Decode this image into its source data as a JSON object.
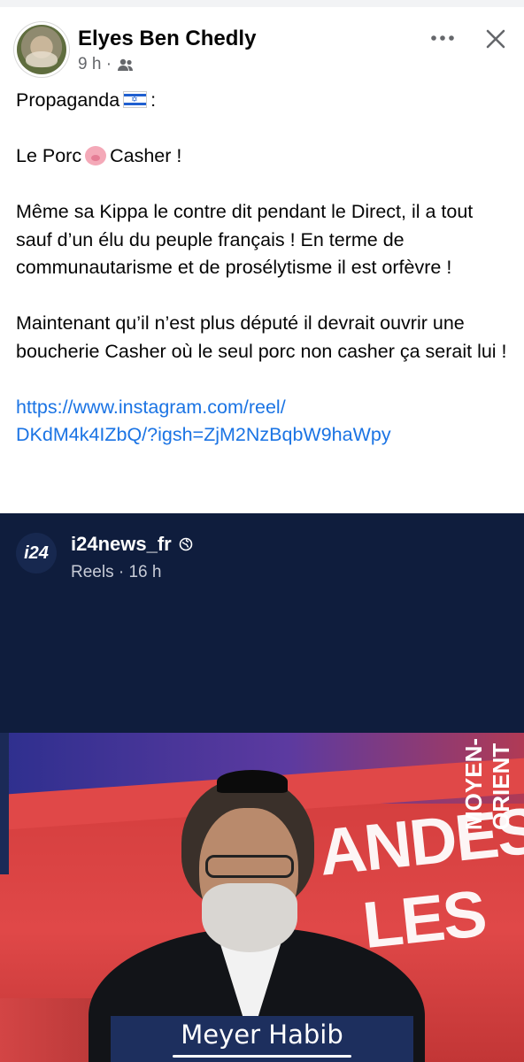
{
  "post": {
    "author": "Elyes Ben Chedly",
    "time": "9 h ·",
    "audience_icon": "friends-icon",
    "paragraphs": {
      "p1": "Propaganda",
      "p1_end": ":",
      "p2_start": "Le Porc",
      "p2_end": "Casher !",
      "p3": "Même sa Kippa le contre dit pendant le Direct, il a tout sauf d’un élu du peuple français ! En terme de communautarisme et de prosélytisme il est orfèvre !",
      "p4": "Maintenant qu’il n’est plus député il devrait ouvrir une boucherie Casher où le seul porc non casher ça serait lui !"
    },
    "link": {
      "line1": "https://www.instagram.com/reel/",
      "line2": "DKdM4k4IZbQ/?igsh=ZjM2NzBqbW9haWpy"
    }
  },
  "reel": {
    "logo": "i24",
    "account": "i24news_fr",
    "meta": "Reels · 16 h",
    "lower_third_name": "Meyer Habib"
  },
  "colors": {
    "link": "#1b74e4",
    "reel_bg": "#0f1d3d",
    "studio_red": "#e04848"
  }
}
